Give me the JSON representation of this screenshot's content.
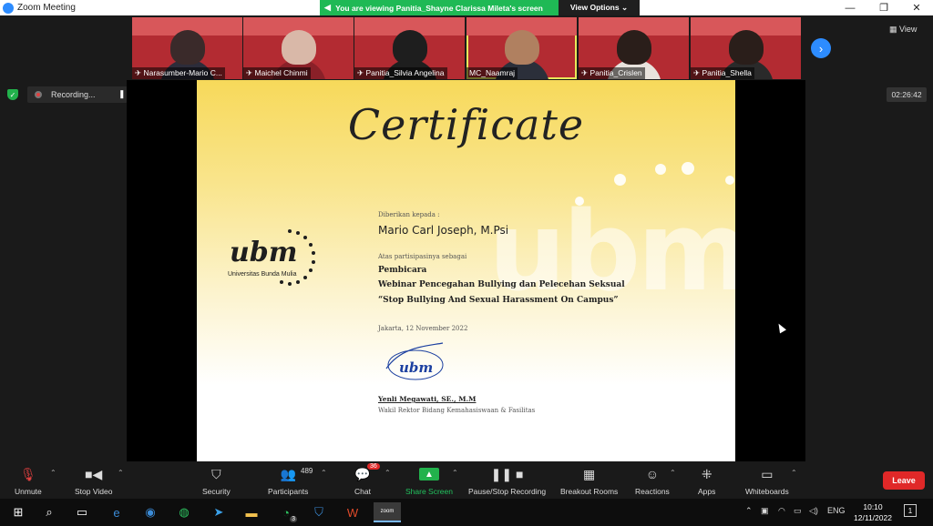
{
  "window": {
    "title": "Zoom Meeting",
    "controls": {
      "minimize": "—",
      "restore": "❐",
      "close": "✕"
    }
  },
  "share_banner": {
    "text": "You are viewing Panitia_Shayne Clarissa Mileta's screen",
    "view_options": "View Options ⌄"
  },
  "video_strip": {
    "tiles": [
      {
        "name": "Narasumber-Mario C...",
        "pinned": true
      },
      {
        "name": "Maichel Chinmi",
        "pinned": true
      },
      {
        "name": "Panitia_Silvia Angelina",
        "pinned": true
      },
      {
        "name": "MC_Naamraj",
        "active": true
      },
      {
        "name": "Panitia_Crislen",
        "pinned": true
      },
      {
        "name": "Panitia_Shella",
        "pinned": true
      }
    ],
    "next_icon": "›",
    "view_label": "▦ View"
  },
  "status": {
    "recording_label": "Recording...",
    "pause_icon": "❚❚",
    "stop_icon": "■",
    "timer": "02:26:42"
  },
  "certificate": {
    "title": "Certificate",
    "given_to_label": "Diberikan kepada :",
    "recipient": "Mario Carl Joseph, M.Psi",
    "participation_label": "Atas partisipasinya sebagai",
    "role": "Pembicara",
    "event": "Webinar Pencegahan Bullying dan Pelecehan Seksual",
    "theme": "“Stop Bullying And Sexual Harassment On Campus”",
    "place_date": "Jakarta, 12 November 2022",
    "signatory": "Yenli Megawati, SE., M.M",
    "signatory_title": "Wakil Rektor Bidang Kemahasiswaan & Fasilitas",
    "logo_text": "ubm",
    "logo_subtitle": "Universitas Bunda Mulia",
    "stamp_text": "ubm",
    "watermark": "ubm"
  },
  "toolbar": {
    "unmute": "Unmute",
    "stop_video": "Stop Video",
    "security": "Security",
    "participants": "Participants",
    "participants_count": "489",
    "chat": "Chat",
    "chat_badge": "36",
    "share_screen": "Share Screen",
    "pause_stop_recording": "Pause/Stop Recording",
    "breakout_rooms": "Breakout Rooms",
    "reactions": "Reactions",
    "apps": "Apps",
    "whiteboards": "Whiteboards",
    "leave": "Leave",
    "caret": "⌃"
  },
  "taskbar": {
    "whatsapp_badge": "3",
    "zoom_label": "zoom",
    "language": "ENG",
    "time": "10:10",
    "date": "12/11/2022",
    "notification_count": "1"
  },
  "colors": {
    "zoom_blue": "#2d8cff",
    "share_green": "#1fb955",
    "leave_red": "#e02828",
    "tile_red": "#b32b32"
  }
}
